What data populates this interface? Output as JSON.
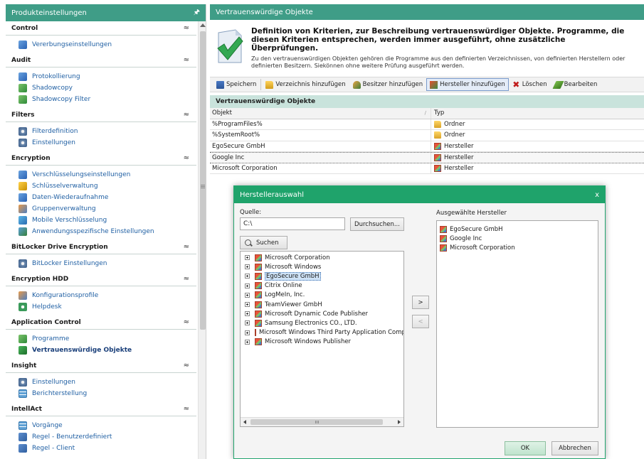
{
  "sidebar": {
    "title": "Produkteinstellungen",
    "pin_glyph": "▐",
    "collapse_glyph": "≈",
    "groups": [
      {
        "title": "Control",
        "items": [
          {
            "label": "Vererbungseinstellungen",
            "icon": "inheritance-icon",
            "active": false
          }
        ]
      },
      {
        "title": "Audit",
        "items": [
          {
            "label": "Protokollierung",
            "icon": "log-icon"
          },
          {
            "label": "Shadowcopy",
            "icon": "shadowcopy-icon"
          },
          {
            "label": "Shadowcopy Filter",
            "icon": "shadowcopy-filter-icon"
          }
        ]
      },
      {
        "title": "Filters",
        "items": [
          {
            "label": "Filterdefinition",
            "icon": "filter-definition-icon"
          },
          {
            "label": "Einstellungen",
            "icon": "settings-icon"
          }
        ]
      },
      {
        "title": "Encryption",
        "items": [
          {
            "label": "Verschlüsselungseinstellungen",
            "icon": "encryption-settings-icon"
          },
          {
            "label": "Schlüsselverwaltung",
            "icon": "key-icon"
          },
          {
            "label": "Daten-Wiederaufnahme",
            "icon": "data-recovery-icon"
          },
          {
            "label": "Gruppenverwaltung",
            "icon": "group-icon"
          },
          {
            "label": "Mobile Verschlüsselung",
            "icon": "mobile-encryption-icon"
          },
          {
            "label": "Anwendungsspezifische Einstellungen",
            "icon": "app-settings-icon"
          }
        ]
      },
      {
        "title": "BitLocker Drive Encryption",
        "items": [
          {
            "label": "BitLocker Einstellungen",
            "icon": "bitlocker-icon"
          }
        ]
      },
      {
        "title": "Encryption HDD",
        "items": [
          {
            "label": "Konfigurationsprofile",
            "icon": "profile-icon"
          },
          {
            "label": "Helpdesk",
            "icon": "helpdesk-icon"
          }
        ]
      },
      {
        "title": "Application Control",
        "items": [
          {
            "label": "Programme",
            "icon": "programs-icon"
          },
          {
            "label": "Vertrauenswürdige Objekte",
            "icon": "trusted-objects-icon",
            "active": true
          }
        ]
      },
      {
        "title": "Insight",
        "items": [
          {
            "label": "Einstellungen",
            "icon": "insight-settings-icon"
          },
          {
            "label": "Berichterstellung",
            "icon": "report-icon"
          }
        ]
      },
      {
        "title": "IntellAct",
        "items": [
          {
            "label": "Vorgänge",
            "icon": "process-icon"
          },
          {
            "label": "Regel - Benutzerdefiniert",
            "icon": "rule-user-icon"
          },
          {
            "label": "Regel - Client",
            "icon": "rule-client-icon"
          }
        ]
      }
    ]
  },
  "main": {
    "title": "Vertrauenswürdige Objekte",
    "intro_title": "Definition von Kriterien, zur Beschreibung vertrauenswürdiger Objekte. Programme, die diesen Kriterien entsprechen, werden immer ausgeführt, ohne zusätzliche Überprüfungen.",
    "intro_text": "Zu den vertrauenswürdigen Objekten gehören die Programme aus den definierten Verzeichnissen, von definierten Herstellern oder definierten Besitzern. Siekönnen ohne weitere Prüfung ausgeführt werden.",
    "toolbar": {
      "save": "Speichern",
      "add_folder": "Verzeichnis hinzufügen",
      "add_owner": "Besitzer hinzufügen",
      "add_vendor": "Hersteller hinzufügen",
      "delete": "Löschen",
      "edit": "Bearbeiten"
    },
    "table": {
      "title": "Vertrauenswürdige Objekte",
      "col_object": "Objekt",
      "col_type": "Typ",
      "rows": [
        {
          "object": "%ProgramFiles%",
          "type": "Ordner",
          "kind": "folder"
        },
        {
          "object": "%SystemRoot%",
          "type": "Ordner",
          "kind": "folder"
        },
        {
          "object": "EgoSecure GmbH",
          "type": "Hersteller",
          "kind": "vendor"
        },
        {
          "object": "Google Inc",
          "type": "Hersteller",
          "kind": "vendor",
          "selected": true
        },
        {
          "object": "Microsoft Corporation",
          "type": "Hersteller",
          "kind": "vendor"
        }
      ]
    }
  },
  "dialog": {
    "title": "Herstellerauswahl",
    "close_glyph": "x",
    "source_label": "Quelle:",
    "source_value": "C:\\",
    "browse": "Durchsuchen...",
    "search": "Suchen",
    "tree_items": [
      "Microsoft Corporation",
      "Microsoft Windows",
      "EgoSecure GmbH",
      "Citrix Online",
      "LogMeIn, Inc.",
      "TeamViewer GmbH",
      "Microsoft Dynamic Code Publisher",
      "Samsung Electronics CO., LTD.",
      "Microsoft Windows Third Party Application Comp",
      "Microsoft Windows Publisher"
    ],
    "tree_selected_index": 2,
    "add_glyph": ">",
    "remove_glyph": "<",
    "scroll_grip": "III",
    "selected_label": "Ausgewählte Hersteller",
    "selected_items": [
      "EgoSecure GmbH",
      "Google Inc",
      "Microsoft Corporation"
    ],
    "ok": "OK",
    "cancel": "Abbrechen"
  },
  "colors": {
    "header": "#3f9d87",
    "dialog_header": "#1fa36b",
    "link": "#1f5fa3"
  }
}
